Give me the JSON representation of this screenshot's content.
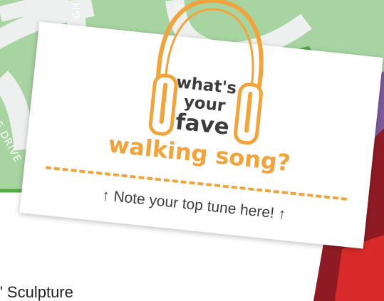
{
  "map": {
    "street_labels": [
      "GH ST",
      "E DRIVE",
      "S"
    ],
    "footer_text": "\" Sculpture"
  },
  "card": {
    "question_line1": "what's",
    "question_line2": "your",
    "question_line3": "fave",
    "question_line4": "walking song?",
    "note_arrow_left": "↑",
    "note_text": "Note your top tune here!",
    "note_arrow_right": "↑",
    "icon": "headphones-icon"
  },
  "colors": {
    "map_green": "#a8d4a2",
    "road": "#eef0ef",
    "route_green": "#4caf3f",
    "accent_orange": "#f2a33a",
    "text_dark": "#3d3d3d",
    "dark_red": "#8e1b24",
    "red": "#d82a2a",
    "purple": "#7d5b9b"
  }
}
